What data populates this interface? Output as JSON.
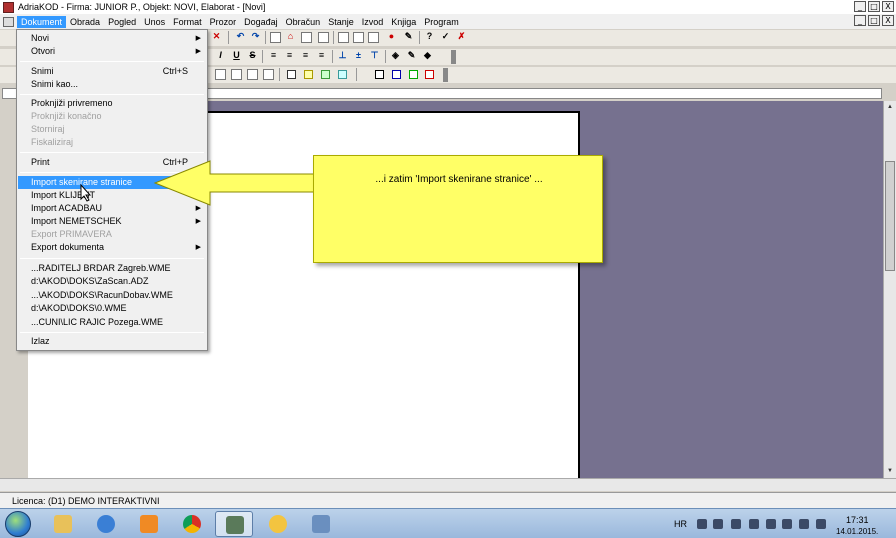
{
  "window": {
    "title": "AdriaKOD - Firma: JUNIOR P.,   Objekt: NOVI,  Elaborat - [Novi]",
    "buttons": [
      "_",
      "□",
      "X"
    ]
  },
  "menubar": {
    "items": [
      "Dokument",
      "Obrada",
      "Pogled",
      "Unos",
      "Format",
      "Prozor",
      "Događaj",
      "Obračun",
      "Stanje",
      "Izvod",
      "Knjiga",
      "Program"
    ],
    "active_index": 0,
    "mdi_buttons": [
      "_",
      "□",
      "X"
    ]
  },
  "dropdown": {
    "items": [
      {
        "label": "Novi",
        "shortcut": "",
        "submenu": true,
        "disabled": false
      },
      {
        "label": "Otvori",
        "shortcut": "",
        "submenu": true,
        "disabled": false
      },
      {
        "label": "Snimi",
        "shortcut": "Ctrl+S",
        "submenu": false,
        "disabled": false
      },
      {
        "label": "Snimi kao...",
        "shortcut": "",
        "submenu": false,
        "disabled": false
      },
      {
        "label": "Proknjiži privremeno",
        "shortcut": "",
        "submenu": false,
        "disabled": false
      },
      {
        "label": "Proknjiži konačno",
        "shortcut": "",
        "submenu": false,
        "disabled": true
      },
      {
        "label": "Storniraj",
        "shortcut": "",
        "submenu": false,
        "disabled": true
      },
      {
        "label": "Fiskaliziraj",
        "shortcut": "",
        "submenu": false,
        "disabled": true
      },
      {
        "label": "Print",
        "shortcut": "Ctrl+P",
        "submenu": false,
        "disabled": false
      },
      {
        "label": "Import skenirane stranice",
        "shortcut": "",
        "submenu": false,
        "disabled": false
      },
      {
        "label": "Import KLIJENT",
        "shortcut": "",
        "submenu": true,
        "disabled": false
      },
      {
        "label": "Import ACADBAU",
        "shortcut": "",
        "submenu": true,
        "disabled": false
      },
      {
        "label": "Import NEMETSCHEK",
        "shortcut": "",
        "submenu": true,
        "disabled": false
      },
      {
        "label": "Export PRIMAVERA",
        "shortcut": "",
        "submenu": false,
        "disabled": true
      },
      {
        "label": "Export dokumenta",
        "shortcut": "",
        "submenu": true,
        "disabled": false
      },
      {
        "label": "...RADITELJ BRDAR Zagreb.WME",
        "shortcut": "",
        "submenu": false,
        "disabled": false
      },
      {
        "label": "d:\\AKOD\\DOKS\\ZaScan.ADZ",
        "shortcut": "",
        "submenu": false,
        "disabled": false
      },
      {
        "label": "...\\AKOD\\DOKS\\RacunDobav.WME",
        "shortcut": "",
        "submenu": false,
        "disabled": false
      },
      {
        "label": "d:\\AKOD\\DOKS\\0.WME",
        "shortcut": "",
        "submenu": false,
        "disabled": false
      },
      {
        "label": "...CUNI\\LIC RAJIC Pozega.WME",
        "shortcut": "",
        "submenu": false,
        "disabled": false
      },
      {
        "label": "Izlaz",
        "shortcut": "",
        "submenu": false,
        "disabled": false
      }
    ],
    "highlighted_index": 9
  },
  "callout": {
    "text": "...i zatim 'Import skenirane stranice' ...",
    "color": "#ffff66"
  },
  "statusbar": {
    "text": "Licenca: (D1) DEMO INTERAKTIVNI"
  },
  "taskbar": {
    "language": "HR",
    "time": "17:31",
    "date": "14.01.2015.",
    "apps": [
      "explorer-icon",
      "internet-explorer-icon",
      "media-player-icon",
      "chrome-icon",
      "adriakod-icon",
      "sun-app-icon",
      "network-app-icon"
    ]
  },
  "colors": {
    "workspace": "#76718f",
    "menu_highlight": "#3399ff"
  }
}
